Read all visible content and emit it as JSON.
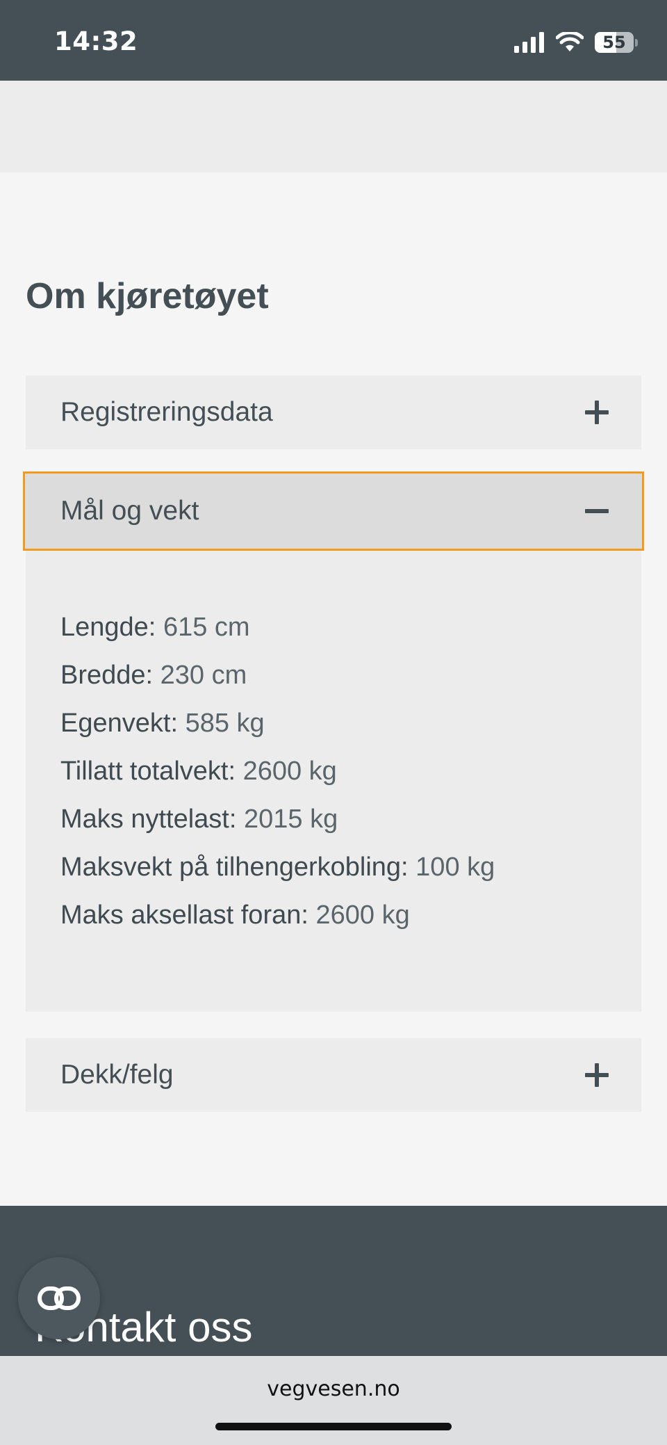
{
  "status_bar": {
    "time": "14:32",
    "battery_level": "55",
    "battery_fraction": 0.55,
    "icons": [
      "signal-icon",
      "wifi-icon",
      "battery-icon"
    ]
  },
  "page": {
    "section_title": "Om kjøretøyet",
    "accordion": [
      {
        "label": "Registreringsdata",
        "state": "collapsed",
        "icon": "plus-icon"
      },
      {
        "label": "Mål og vekt",
        "state": "expanded",
        "icon": "minus-icon"
      },
      {
        "label": "Dekk/felg",
        "state": "collapsed",
        "icon": "plus-icon"
      }
    ],
    "specs": [
      {
        "key": "Lengde:",
        "value": "615 cm"
      },
      {
        "key": "Bredde:",
        "value": "230 cm"
      },
      {
        "key": "Egenvekt:",
        "value": "585 kg"
      },
      {
        "key": "Tillatt totalvekt:",
        "value": "2600 kg"
      },
      {
        "key": "Maks nyttelast:",
        "value": "2015 kg"
      },
      {
        "key": "Maksvekt på tilhengerkobling:",
        "value": "100 kg"
      },
      {
        "key": "Maks aksellast foran:",
        "value": "2600 kg"
      }
    ]
  },
  "footer": {
    "contact_title": "Kontakt oss",
    "fab_icon": "link-icon"
  },
  "browser": {
    "url": "vegvesen.no"
  },
  "colors": {
    "header_bg": "#444f56",
    "focus_outline": "#f29a1d",
    "text": "#444f55",
    "panel_bg": "#ececec"
  }
}
